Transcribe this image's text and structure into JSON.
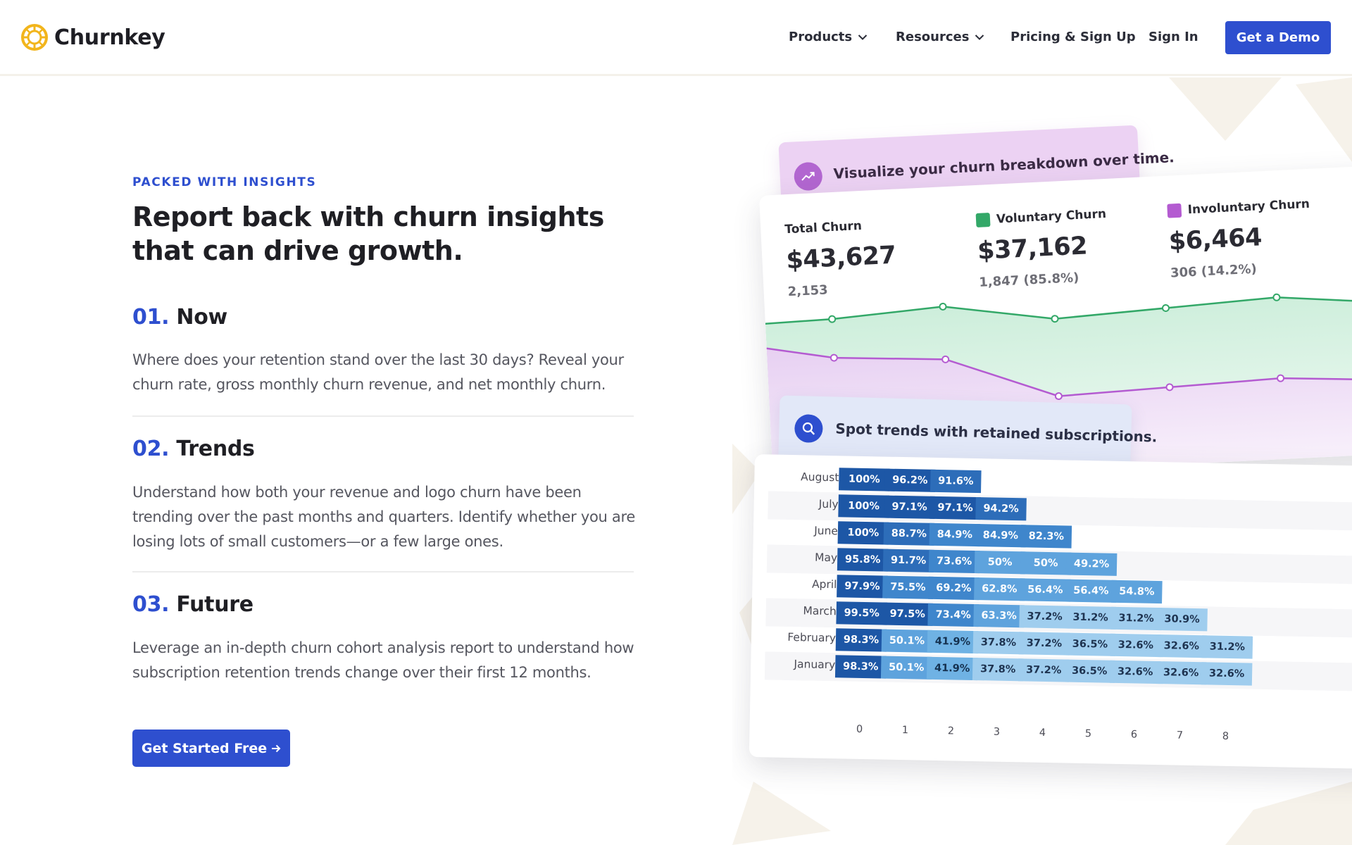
{
  "brand": {
    "name": "Churnkey",
    "logo_icon": "churnkey-logo-icon",
    "accent": "#2e4fcf",
    "logo_color": "#f2b51c"
  },
  "nav": {
    "products": "Products",
    "resources": "Resources",
    "pricing": "Pricing & Sign Up",
    "signin": "Sign In",
    "demo": "Get a Demo"
  },
  "hero": {
    "eyebrow": "PACKED WITH INSIGHTS",
    "headline": "Report back with churn insights that can drive growth.",
    "items": [
      {
        "num": "01.",
        "title": "Now",
        "body": "Where does your retention stand over the last 30 days? Reveal your churn rate, gross monthly churn revenue, and net monthly churn."
      },
      {
        "num": "02.",
        "title": "Trends",
        "body": "Understand how both your revenue and logo churn have been trending over the past months and quarters. Identify whether you are losing lots of small customers—or a few large ones."
      },
      {
        "num": "03.",
        "title": "Future",
        "body": "Leverage an in-depth churn cohort analysis report to understand how subscription retention trends change over their first 12 months."
      }
    ],
    "cta": "Get Started Free",
    "cta_icon": "arrow-right-icon"
  },
  "breakdown": {
    "caption": "Visualize your churn breakdown over time.",
    "caption_icon": "trend-up-icon",
    "total": {
      "label": "Total Churn",
      "value": "$43,627",
      "sub": "2,153"
    },
    "voluntary": {
      "label": "Voluntary Churn",
      "value": "$37,162",
      "sub": "1,847 (85.8%)",
      "color": "#33a868"
    },
    "involuntary": {
      "label": "Involuntary Churn",
      "value": "$6,464",
      "sub": "306 (14.2%)",
      "color": "#b45bd1"
    }
  },
  "chart_data": {
    "type": "area",
    "x": [
      0,
      1,
      2,
      3,
      4,
      5
    ],
    "series": [
      {
        "name": "Voluntary Churn",
        "values": [
          0.92,
          0.96,
          0.86,
          0.89,
          0.92,
          0.86
        ]
      },
      {
        "name": "Involuntary Churn",
        "values": [
          0.7,
          0.66,
          0.42,
          0.44,
          0.46,
          0.42
        ]
      }
    ],
    "ylim": [
      0,
      1
    ],
    "grid": false
  },
  "cohort": {
    "caption": "Spot trends with retained subscriptions.",
    "caption_icon": "search-icon",
    "columns": [
      "0",
      "1",
      "2",
      "3",
      "4",
      "5",
      "6",
      "7",
      "8"
    ],
    "rows": [
      {
        "month": "August",
        "values": [
          "100%",
          "96.2%",
          "91.6%"
        ]
      },
      {
        "month": "July",
        "values": [
          "100%",
          "97.1%",
          "97.1%",
          "94.2%"
        ]
      },
      {
        "month": "June",
        "values": [
          "100%",
          "88.7%",
          "84.9%",
          "84.9%",
          "82.3%"
        ]
      },
      {
        "month": "May",
        "values": [
          "95.8%",
          "91.7%",
          "73.6%",
          "50%",
          "50%",
          "49.2%"
        ]
      },
      {
        "month": "April",
        "values": [
          "97.9%",
          "75.5%",
          "69.2%",
          "62.8%",
          "56.4%",
          "56.4%",
          "54.8%"
        ]
      },
      {
        "month": "March",
        "values": [
          "99.5%",
          "97.5%",
          "73.4%",
          "63.3%",
          "37.2%",
          "31.2%",
          "31.2%",
          "30.9%"
        ]
      },
      {
        "month": "February",
        "values": [
          "98.3%",
          "50.1%",
          "41.9%",
          "37.8%",
          "37.2%",
          "36.5%",
          "32.6%",
          "32.6%",
          "31.2%"
        ]
      },
      {
        "month": "January",
        "values": [
          "98.3%",
          "50.1%",
          "41.9%",
          "37.8%",
          "37.2%",
          "36.5%",
          "32.6%",
          "32.6%",
          "32.6%"
        ]
      }
    ]
  }
}
